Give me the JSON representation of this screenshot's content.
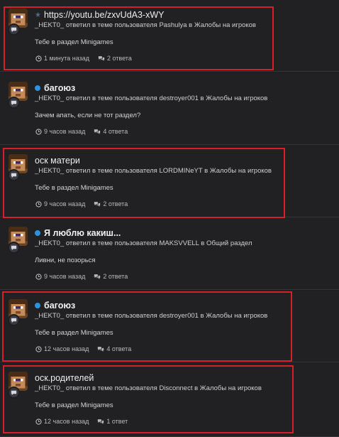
{
  "feed": {
    "items": [
      {
        "title": "https://youtu.be/zxvUdA3-xWY",
        "title_icon": "star-icon",
        "meta": "_HEKT0_ ответил в теме пользователя Pashulya в Жалобы на игроков",
        "excerpt": "Тебе в раздел Minigames",
        "time": "1 минута назад",
        "replies": "2 ответа",
        "highlighted": true
      },
      {
        "title": "багоюз",
        "title_icon": "unread-dot",
        "meta": "_HEKT0_ ответил в теме пользователя destroyer001 в Жалобы на игроков",
        "excerpt": "Зачем апать, если не тот раздел?",
        "time": "9 часов назад",
        "replies": "4 ответа",
        "highlighted": false
      },
      {
        "title": "оск матери",
        "title_icon": "",
        "meta": "_HEKT0_ ответил в теме пользователя LORDMINeYT в Жалобы на игроков",
        "excerpt": "Тебе в раздел Minigames",
        "time": "9 часов назад",
        "replies": "2 ответа",
        "highlighted": true
      },
      {
        "title": "Я люблю какиш...",
        "title_icon": "unread-dot",
        "meta": "_HEKT0_ ответил в теме пользователя MAKSVVELL в Общий раздел",
        "excerpt": "Ливни, не позорься",
        "time": "9 часов назад",
        "replies": "2 ответа",
        "highlighted": false
      },
      {
        "title": "багоюз",
        "title_icon": "unread-dot",
        "meta": "_HEKT0_ ответил в теме пользователя destroyer001 в Жалобы на игроков",
        "excerpt": "Тебе в раздел Minigames",
        "time": "12 часов назад",
        "replies": "4 ответа",
        "highlighted": true
      },
      {
        "title": "оск.родителей",
        "title_icon": "",
        "meta": "_HEKT0_ ответил в теме пользователя Disconnect в Жалобы на игроков",
        "excerpt": "Тебе в раздел Minigames",
        "time": "12 часов назад",
        "replies": "1 ответ",
        "highlighted": true
      }
    ]
  },
  "colors": {
    "background": "#1f1f22",
    "highlight": "#d61f2a",
    "unread_dot": "#2b93e0"
  }
}
